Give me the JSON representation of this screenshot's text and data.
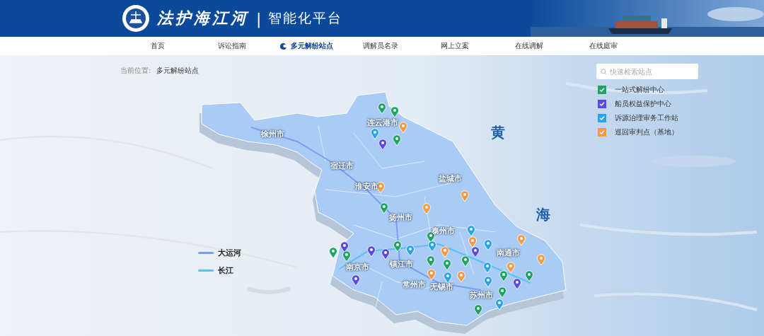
{
  "header": {
    "title": "法护海江河",
    "separator": "|",
    "subtitle": "智能化平台"
  },
  "nav": [
    {
      "label": "首页",
      "selected": false
    },
    {
      "label": "诉讼指南",
      "selected": false
    },
    {
      "label": "多元解纷站点",
      "selected": true
    },
    {
      "label": "调解员名录",
      "selected": false
    },
    {
      "label": "网上立案",
      "selected": false
    },
    {
      "label": "在线调解",
      "selected": false
    },
    {
      "label": "在线庭审",
      "selected": false
    }
  ],
  "breadcrumb": {
    "label": "当前位置:",
    "current": "多元解纷站点"
  },
  "search": {
    "placeholder": "快速检索站点"
  },
  "categories": [
    {
      "label": "一站式解纷中心",
      "checked": true,
      "color": "#1fa463"
    },
    {
      "label": "船员权益保护中心",
      "checked": true,
      "color": "#5a4ae3"
    },
    {
      "label": "诉源治理审务工作站",
      "checked": true,
      "color": "#27a3e6"
    },
    {
      "label": "巡回审判点（基地）",
      "checked": true,
      "color": "#f39a45"
    }
  ],
  "cities": [
    "连云港市",
    "徐州市",
    "宿迁市",
    "盐城市",
    "淮安市",
    "扬州市",
    "泰州市",
    "南通市",
    "南京市",
    "镇江市",
    "常州市",
    "无锡市",
    "苏州市"
  ],
  "sea_label": [
    "黄",
    "海"
  ],
  "rivers": [
    {
      "label": "大运河",
      "color": "#7a9ff0"
    },
    {
      "label": "长江",
      "color": "#5cc0f5"
    }
  ]
}
